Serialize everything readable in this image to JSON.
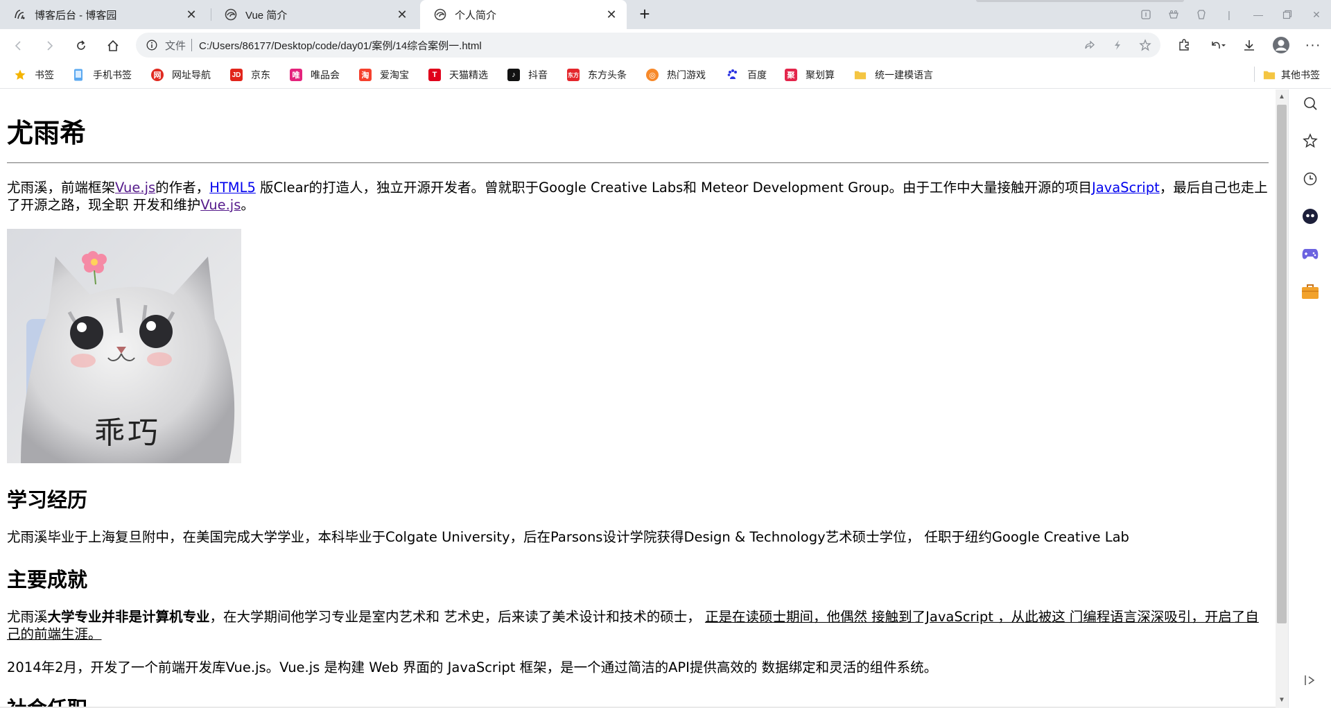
{
  "tabs": [
    {
      "title": "博客后台 - 博客园",
      "icon": "blog-logo-icon",
      "active": false
    },
    {
      "title": "Vue 简介",
      "icon": "edge-page-icon",
      "active": false
    },
    {
      "title": "个人简介",
      "icon": "edge-page-icon",
      "active": true
    }
  ],
  "address": {
    "scheme_label": "文件",
    "url": "C:/Users/86177/Desktop/code/day01/案例/14综合案例一.html"
  },
  "bookmarks": [
    {
      "label": "书签",
      "icon": "star-icon",
      "color": "#f4b400"
    },
    {
      "label": "手机书签",
      "icon": "phone-icon",
      "color": "#5aa8f0"
    },
    {
      "label": "网址导航",
      "icon": "nav-icon",
      "color": "#e02a20"
    },
    {
      "label": "京东",
      "icon": "jd-icon",
      "color": "#e1251b"
    },
    {
      "label": "唯品会",
      "icon": "vip-icon",
      "color": "#e4237c"
    },
    {
      "label": "爱淘宝",
      "icon": "taobao-icon",
      "color": "#f5402d"
    },
    {
      "label": "天猫精选",
      "icon": "tmall-icon",
      "color": "#e0001b"
    },
    {
      "label": "抖音",
      "icon": "douyin-icon",
      "color": "#111111"
    },
    {
      "label": "东方头条",
      "icon": "toutiao-icon",
      "color": "#e4262c"
    },
    {
      "label": "热门游戏",
      "icon": "game-icon",
      "color": "#f7892a"
    },
    {
      "label": "百度",
      "icon": "baidu-icon",
      "color": "#2932e1"
    },
    {
      "label": "聚划算",
      "icon": "juhuasuan-icon",
      "color": "#e3254b"
    },
    {
      "label": "统一建模语言",
      "icon": "folder-icon",
      "color": "#f4c542"
    }
  ],
  "other_bookmarks": {
    "label": "其他书签",
    "icon": "folder-icon"
  },
  "page": {
    "title": "尤雨希",
    "intro": {
      "t1": "尤雨溪，前端框架",
      "link1": "Vue.js",
      "t2": "的作者，",
      "link2": "HTML5",
      "t3": " 版Clear的打造人，独立开源开发者。曾就职于Google Creative Labs和 Meteor Development Group。由于工作中大量接触开源的项目",
      "link3": "JavaScript",
      "t4": "，最后自己也走上了开源之路，现全职 开发和维护",
      "link4": "Vue.js",
      "t5": "。"
    },
    "image_caption": "乖巧",
    "section_education": "学习经历",
    "education_text": "尤雨溪毕业于上海复旦附中，在美国完成大学学业，本科毕业于Colgate University，后在Parsons设计学院获得Design & Technology艺术硕士学位， 任职于纽约Google Creative Lab",
    "section_achievements": "主要成就",
    "achievements": {
      "t1": "尤雨溪",
      "bold": "大学专业并非是计算机专业",
      "t2": "，在大学期间他学习专业是室内艺术和 艺术史，后来读了美术设计和技术的硕士， ",
      "underline": "正是在读硕士期间，他偶然 接触到了JavaScript ，从此被这 门编程语言深深吸引，开启了自己的前端生涯。"
    },
    "achievements_text2": "2014年2月，开发了一个前端开发库Vue.js。Vue.js 是构建 Web 界面的 JavaScript 框架，是一个通过简洁的API提供高效的 数据绑定和灵活的组件系统。",
    "section_social": "社会任职"
  }
}
